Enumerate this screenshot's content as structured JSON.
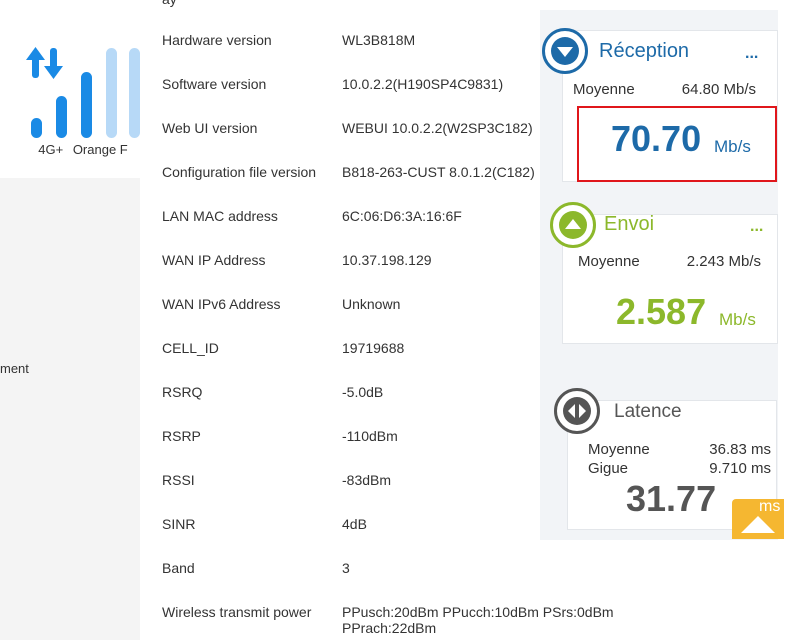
{
  "network": {
    "type": "4G+",
    "operator": "Orange F"
  },
  "left_cut_label": "ment",
  "top_cut_text": "ay",
  "device_info": [
    {
      "label": "Hardware version",
      "value": "WL3B818M"
    },
    {
      "label": "Software version",
      "value": "10.0.2.2(H190SP4C9831)"
    },
    {
      "label": "Web UI version",
      "value": "WEBUI 10.0.2.2(W2SP3C182)"
    },
    {
      "label": "Configuration file version",
      "value": "B818-263-CUST 8.0.1.2(C182)"
    },
    {
      "label": "LAN MAC address",
      "value": "6C:06:D6:3A:16:6F"
    },
    {
      "label": "WAN IP Address",
      "value": "10.37.198.129"
    },
    {
      "label": "WAN IPv6 Address",
      "value": "Unknown"
    },
    {
      "label": "CELL_ID",
      "value": "19719688"
    },
    {
      "label": "RSRQ",
      "value": "-5.0dB"
    },
    {
      "label": "RSRP",
      "value": "-110dBm"
    },
    {
      "label": "RSSI",
      "value": "-83dBm"
    },
    {
      "label": "SINR",
      "value": "4dB"
    },
    {
      "label": "Band",
      "value": "3"
    },
    {
      "label": "Wireless transmit power",
      "value": "PPusch:20dBm PPucch:10dBm PSrs:0dBm",
      "value2": "PPrach:22dBm"
    }
  ],
  "speedtest": {
    "reception": {
      "title": "Réception",
      "menu": "...",
      "avg_label": "Moyenne",
      "avg_value": "64.80 Mb/s",
      "value": "70.70",
      "unit": "Mb/s",
      "color": "#1d6aa8"
    },
    "envoi": {
      "title": "Envoi",
      "menu": "...",
      "avg_label": "Moyenne",
      "avg_value": "2.243 Mb/s",
      "value": "2.587",
      "unit": "Mb/s",
      "color": "#8cb82b"
    },
    "latence": {
      "title": "Latence",
      "avg_label": "Moyenne",
      "avg_value": "36.83 ms",
      "jitter_label": "Gigue",
      "jitter_value": "9.710 ms",
      "value": "31.77",
      "unit": "ms",
      "color": "#555555"
    }
  },
  "colors": {
    "signal_strong": "#1a8ae5",
    "signal_weak": "#b7d9f7",
    "highlight": "#e0161b",
    "scroll_button": "#f5b731"
  }
}
